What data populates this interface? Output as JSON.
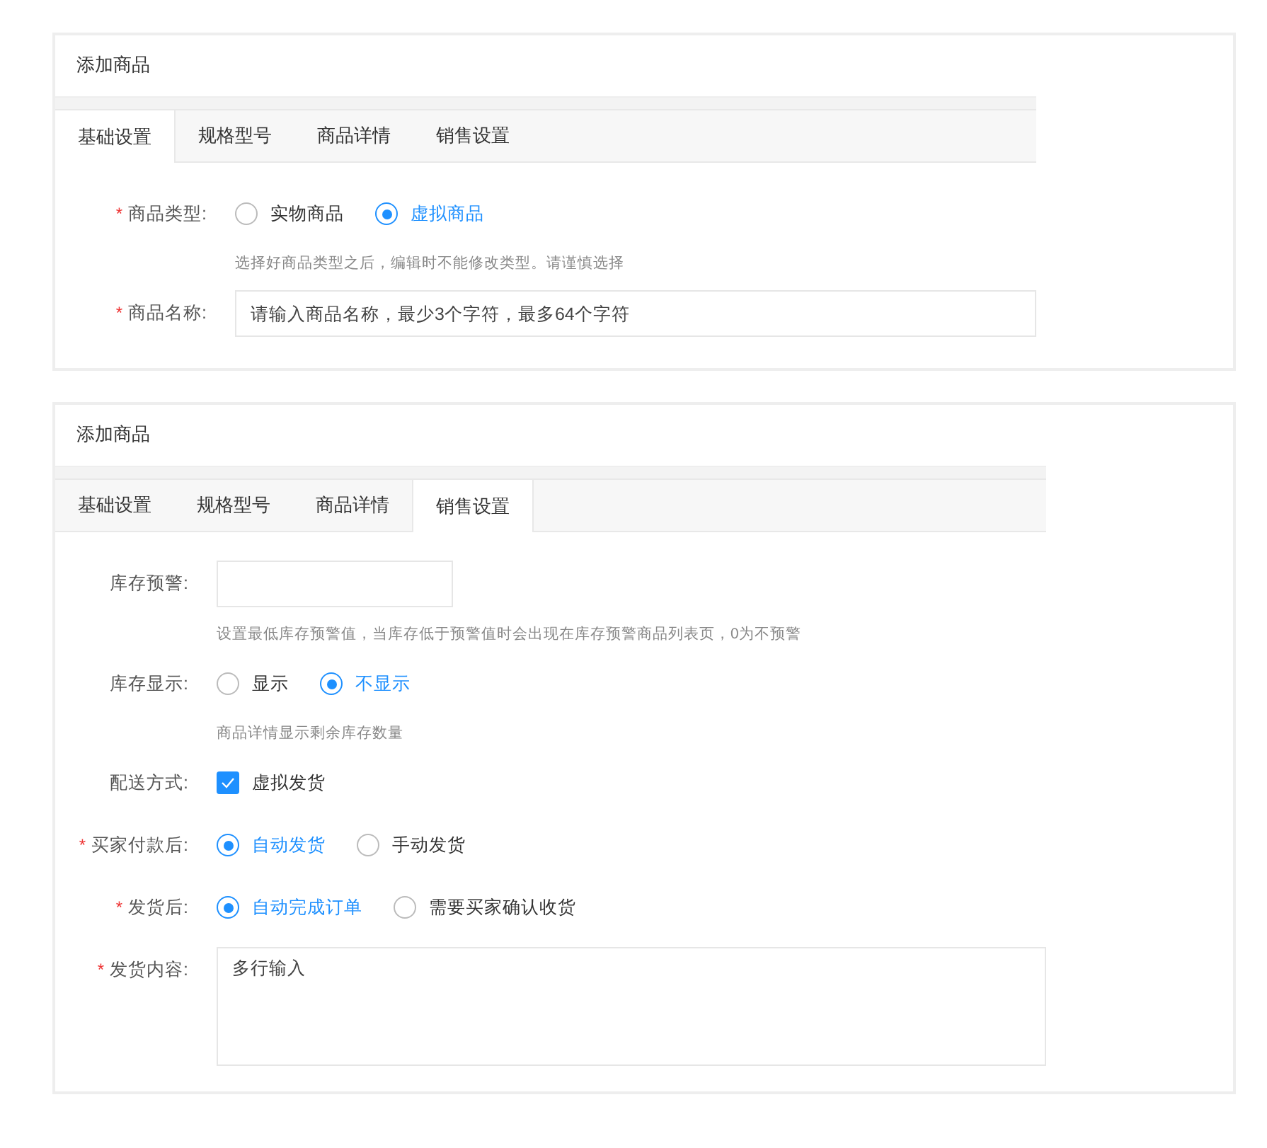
{
  "panels": [
    {
      "title": "添加商品",
      "tabs": [
        {
          "label": "基础设置",
          "selected": true
        },
        {
          "label": "规格型号",
          "selected": false
        },
        {
          "label": "商品详情",
          "selected": false
        },
        {
          "label": "销售设置",
          "selected": false
        }
      ],
      "fields": [
        {
          "kind": "radio",
          "label": "商品类型:",
          "required_mark": "*",
          "options": [
            {
              "label": "实物商品",
              "selected": false
            },
            {
              "label": "虚拟商品",
              "selected": true
            }
          ],
          "hint": "选择好商品类型之后，编辑时不能修改类型。请谨慎选择"
        },
        {
          "kind": "text",
          "label": "商品名称:",
          "required_mark": "*",
          "placeholder": "请输入商品名称，最少3个字符，最多64个字符"
        }
      ]
    },
    {
      "title": "添加商品",
      "tabs": [
        {
          "label": "基础设置",
          "selected": false
        },
        {
          "label": "规格型号",
          "selected": false
        },
        {
          "label": "商品详情",
          "selected": false
        },
        {
          "label": "销售设置",
          "selected": true
        }
      ],
      "fields": [
        {
          "kind": "short_text",
          "label": "库存预警:",
          "hint": "设置最低库存预警值，当库存低于预警值时会出现在库存预警商品列表页，0为不预警"
        },
        {
          "kind": "radio",
          "label": "库存显示:",
          "options": [
            {
              "label": "显示",
              "selected": false
            },
            {
              "label": "不显示",
              "selected": true
            }
          ],
          "hint": "商品详情显示剩余库存数量"
        },
        {
          "kind": "checkbox",
          "label": "配送方式:",
          "options": [
            {
              "label": "虚拟发货",
              "checked": true
            }
          ]
        },
        {
          "kind": "radio",
          "label": "买家付款后:",
          "required_mark": "*",
          "options": [
            {
              "label": "自动发货",
              "selected": true
            },
            {
              "label": "手动发货",
              "selected": false
            }
          ]
        },
        {
          "kind": "radio",
          "label": "发货后:",
          "required_mark": "*",
          "options": [
            {
              "label": "自动完成订单",
              "selected": true
            },
            {
              "label": "需要买家确认收货",
              "selected": false
            }
          ]
        },
        {
          "kind": "textarea",
          "label": "发货内容:",
          "required_mark": "*",
          "placeholder": "多行输入"
        }
      ]
    }
  ]
}
